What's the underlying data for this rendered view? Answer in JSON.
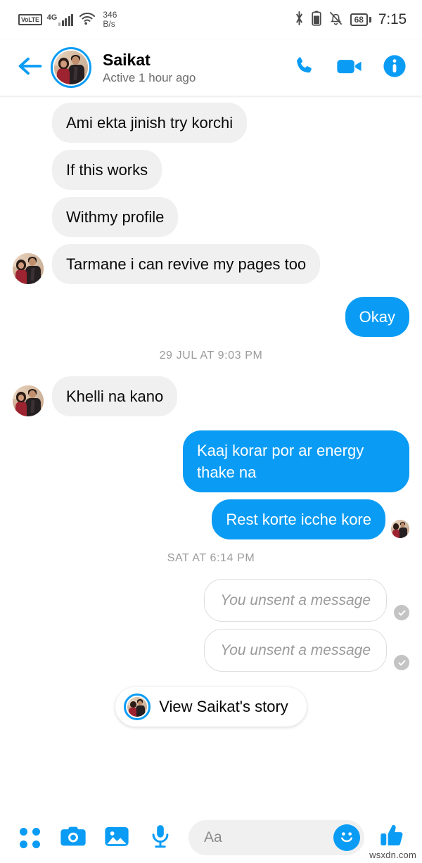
{
  "status_bar": {
    "volte": "VoLTE",
    "network": "4G",
    "data_rate_value": "346",
    "data_rate_unit": "B/s",
    "battery": "68",
    "time": "7:15",
    "icons": [
      "volte-badge",
      "signal-bars-icon",
      "wifi-icon",
      "bluetooth-icon",
      "battery-icon",
      "mute-bell-icon"
    ]
  },
  "header": {
    "back_icon": "back-arrow-icon",
    "name": "Saikat",
    "status": "Active 1 hour ago",
    "call_icon": "phone-call-icon",
    "video_icon": "video-camera-icon",
    "info_icon": "info-circle-icon",
    "accent_color": "#0A9CF5"
  },
  "thread": {
    "messages": [
      {
        "id": "m1",
        "side": "in",
        "text": "Ami ekta jinish try korchi",
        "show_avatar": false
      },
      {
        "id": "m2",
        "side": "in",
        "text": "If this works",
        "show_avatar": false
      },
      {
        "id": "m3",
        "side": "in",
        "text": "Withmy profile",
        "show_avatar": false
      },
      {
        "id": "m4",
        "side": "in",
        "text": "Tarmane i can revive my pages too",
        "show_avatar": true
      },
      {
        "id": "m5",
        "side": "out",
        "text": "Okay"
      },
      {
        "id": "d1",
        "type": "divider",
        "text": "29 JUL AT 9:03 PM"
      },
      {
        "id": "m6",
        "side": "in",
        "text": "Khelli na kano",
        "show_avatar": true
      },
      {
        "id": "m7",
        "side": "out",
        "text": "Kaaj korar por ar energy thake na"
      },
      {
        "id": "m8",
        "side": "out",
        "text": "Rest korte icche kore",
        "seen_avatar": true
      },
      {
        "id": "d2",
        "type": "divider",
        "text": "SAT AT 6:14 PM"
      },
      {
        "id": "m9",
        "side": "out",
        "text": "You unsent a message",
        "unsent": true,
        "delivered": true
      },
      {
        "id": "m10",
        "side": "out",
        "text": "You unsent a message",
        "unsent": true,
        "delivered": true
      }
    ],
    "divider_1": "29 JUL AT 9:03 PM",
    "divider_2": "SAT AT 6:14 PM",
    "msg_1": "Ami ekta jinish try korchi",
    "msg_2": "If this works",
    "msg_3": "Withmy profile",
    "msg_4": "Tarmane i can revive my pages too",
    "msg_5": "Okay",
    "msg_6": "Khelli na kano",
    "msg_7": "Kaaj korar por ar energy thake na",
    "msg_8": "Rest korte icche kore",
    "msg_9": "You unsent a message",
    "msg_10": "You unsent a message",
    "bubble_in_color": "#F0F0F0",
    "bubble_out_color": "#0A9CF5"
  },
  "story": {
    "label": "View Saikat's story"
  },
  "toolbar": {
    "apps_icon": "four-dots-grid-icon",
    "camera_icon": "camera-icon",
    "gallery_icon": "image-gallery-icon",
    "mic_icon": "microphone-icon",
    "composer_placeholder": "Aa",
    "emoji_icon": "smiley-face-icon",
    "like_icon": "thumbs-up-icon"
  },
  "watermark": "wsxdn.com"
}
